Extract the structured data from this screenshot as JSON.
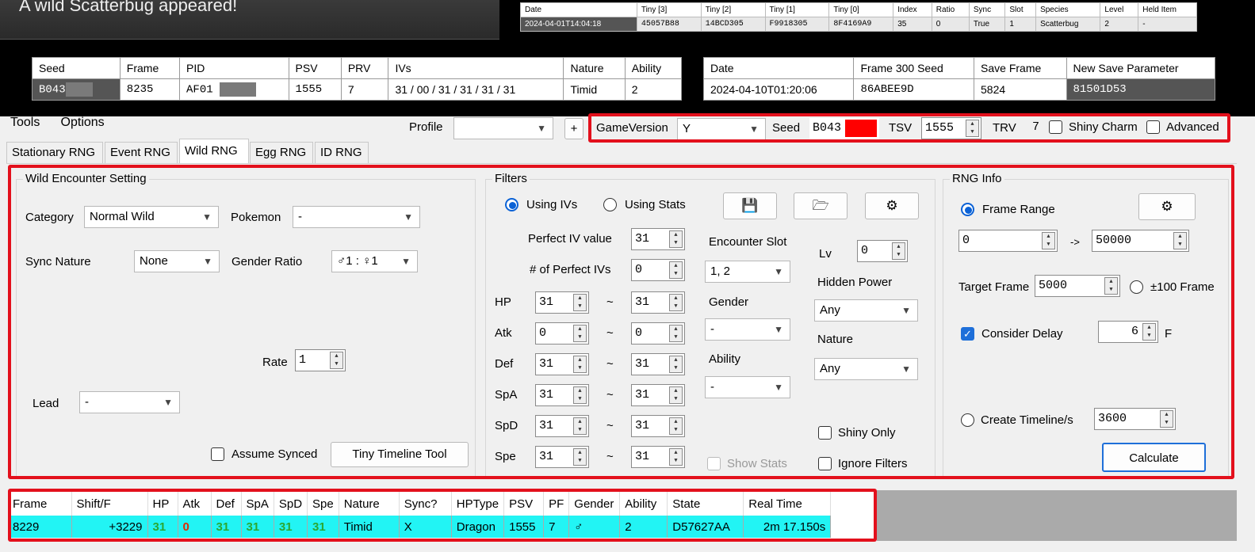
{
  "banner": {
    "message": "A wild Scatterbug appeared!"
  },
  "tiny_table": {
    "headers": [
      "Date",
      "Tiny [3]",
      "Tiny [2]",
      "Tiny [1]",
      "Tiny [0]",
      "Index",
      "Ratio",
      "Sync",
      "Slot",
      "Species",
      "Level",
      "Held Item"
    ],
    "row": [
      "2024-04-01T14:04:18",
      "45057B88",
      "14BCD305",
      "F9918305",
      "8F4169A9",
      "35",
      "0",
      "True",
      "1",
      "Scatterbug",
      "2",
      "-"
    ]
  },
  "seed_table": {
    "headers": [
      "Seed",
      "Frame",
      "PID",
      "PSV",
      "PRV",
      "IVs",
      "Nature",
      "Ability"
    ],
    "row": {
      "seed": "B043",
      "frame": "8235",
      "pid": "AF01",
      "psv": "1555",
      "prv": "7",
      "ivs": "31 / 00 / 31 / 31 / 31 / 31",
      "nature": "Timid",
      "ability": "2"
    }
  },
  "save_table": {
    "headers": [
      "Date",
      "Frame 300 Seed",
      "Save Frame",
      "New Save Parameter"
    ],
    "row": [
      "2024-04-10T01:20:06",
      "86ABEE9D",
      "5824",
      "81501D53"
    ]
  },
  "menu": {
    "tools": "Tools",
    "options": "Options"
  },
  "toolbar": {
    "profile_label": "Profile",
    "profile_value": "",
    "plus": "+",
    "gameversion_label": "GameVersion",
    "gameversion_value": "Y",
    "seed_label": "Seed",
    "seed_value": "B043",
    "tsv_label": "TSV",
    "tsv_value": "1555",
    "trv_label": "TRV",
    "trv_value": "7",
    "shiny_charm": "Shiny Charm",
    "advanced": "Advanced"
  },
  "tabs": [
    "Stationary RNG",
    "Event RNG",
    "Wild RNG",
    "Egg RNG",
    "ID RNG"
  ],
  "wild": {
    "title": "Wild Encounter Setting",
    "category_label": "Category",
    "category_value": "Normal Wild",
    "pokemon_label": "Pokemon",
    "pokemon_value": "-",
    "sync_label": "Sync Nature",
    "sync_value": "None",
    "gender_ratio_label": "Gender Ratio",
    "gender_ratio_value": "♂1 : ♀1",
    "rate_label": "Rate",
    "rate_value": "1",
    "lead_label": "Lead",
    "lead_value": "-",
    "assume_synced": "Assume Synced",
    "tiny_timeline": "Tiny Timeline Tool"
  },
  "filters": {
    "title": "Filters",
    "using_ivs": "Using IVs",
    "using_stats": "Using Stats",
    "perfect_iv_label": "Perfect IV value",
    "perfect_iv_value": "31",
    "num_perfect_label": "# of Perfect IVs",
    "num_perfect_value": "0",
    "stats": [
      {
        "label": "HP",
        "min": "31",
        "max": "31"
      },
      {
        "label": "Atk",
        "min": "0",
        "max": "0"
      },
      {
        "label": "Def",
        "min": "31",
        "max": "31"
      },
      {
        "label": "SpA",
        "min": "31",
        "max": "31"
      },
      {
        "label": "SpD",
        "min": "31",
        "max": "31"
      },
      {
        "label": "Spe",
        "min": "31",
        "max": "31"
      }
    ],
    "tilde": "~",
    "encounter_slot_label": "Encounter Slot",
    "encounter_slot_value": "1, 2",
    "gender_label": "Gender",
    "gender_value": "-",
    "ability_label": "Ability",
    "ability_value": "-",
    "lv_label": "Lv",
    "lv_value": "0",
    "hidden_power_label": "Hidden Power",
    "hidden_power_value": "Any",
    "nature_label": "Nature",
    "nature_value": "Any",
    "show_stats": "Show Stats",
    "shiny_only": "Shiny Only",
    "ignore_filters": "Ignore Filters"
  },
  "rnginfo": {
    "title": "RNG Info",
    "frame_range": "Frame Range",
    "range_start": "0",
    "range_arrow": "->",
    "range_end": "50000",
    "target_frame_label": "Target Frame",
    "target_frame_value": "5000",
    "pm100": "±100 Frame",
    "consider_delay": "Consider Delay",
    "delay_value": "6",
    "delay_unit": "F",
    "create_timeline": "Create Timeline/s",
    "timeline_value": "3600",
    "calculate": "Calculate"
  },
  "results": {
    "headers": [
      "Frame",
      "Shift/F",
      "HP",
      "Atk",
      "Def",
      "SpA",
      "SpD",
      "Spe",
      "Nature",
      "Sync?",
      "HPType",
      "PSV",
      "PF",
      "Gender",
      "Ability",
      "State",
      "Real Time"
    ],
    "row": [
      "8229",
      "+3229",
      "31",
      "0",
      "31",
      "31",
      "31",
      "31",
      "Timid",
      "X",
      "Dragon",
      "1555",
      "7",
      "♂",
      "2",
      "D57627AA",
      "2m 17.150s"
    ]
  },
  "colors": {
    "highlight_red": "#e3101c",
    "result_row": "#22f4f4",
    "iv_good": "#2aa832",
    "iv_bad": "#e02b00"
  }
}
